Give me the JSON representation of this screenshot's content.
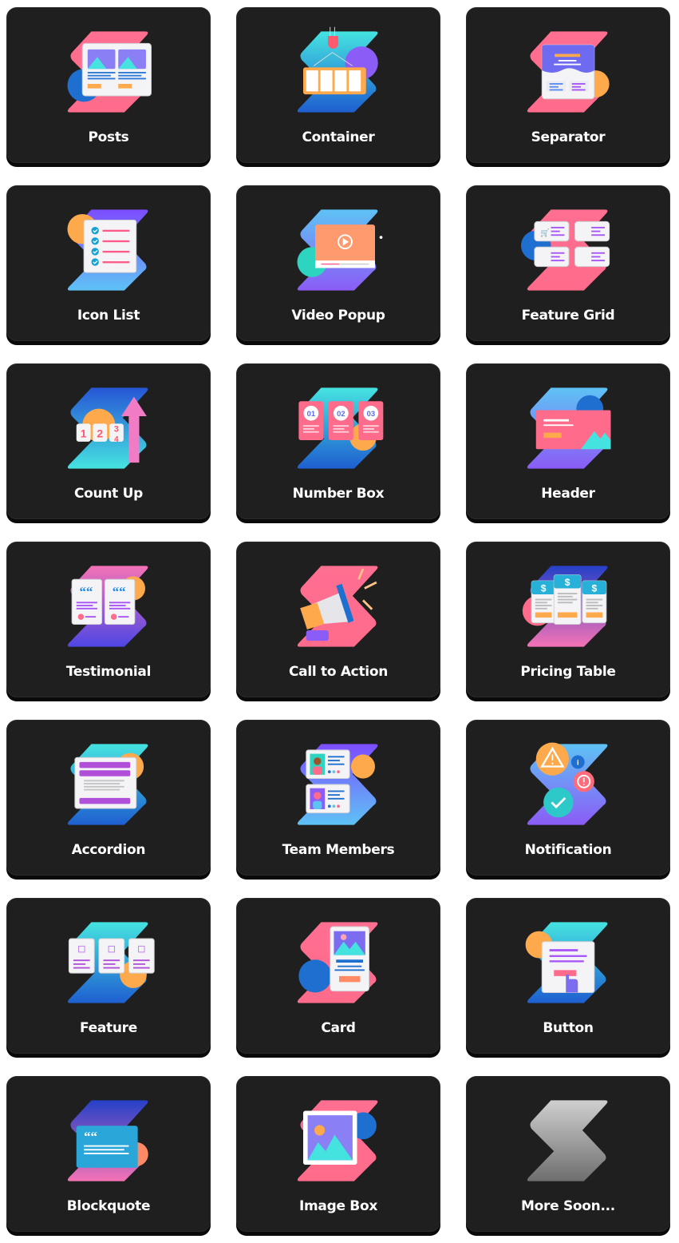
{
  "widgets": [
    {
      "label": "Posts",
      "icon": "posts-icon",
      "motif": "pink",
      "accent": "#1e6fd0"
    },
    {
      "label": "Container",
      "icon": "container-icon",
      "motif": "cyan-blue",
      "accent": "#8b5cf6"
    },
    {
      "label": "Separator",
      "icon": "separator-icon",
      "motif": "pink",
      "accent": "#ffa94d"
    },
    {
      "label": "Icon List",
      "icon": "icon-list-icon",
      "motif": "purple-sky",
      "accent": "#ffa94d"
    },
    {
      "label": "Video Popup",
      "icon": "video-popup-icon",
      "motif": "sky-purple",
      "accent": "#2dd4bf"
    },
    {
      "label": "Feature Grid",
      "icon": "feature-grid-icon",
      "motif": "pink",
      "accent": "#1e6fd0"
    },
    {
      "label": "Count Up",
      "icon": "count-up-icon",
      "motif": "blue-cyan",
      "accent": "#ffa94d"
    },
    {
      "label": "Number Box",
      "icon": "number-box-icon",
      "motif": "cyan-blue",
      "accent": "#ffa94d"
    },
    {
      "label": "Header",
      "icon": "header-icon",
      "motif": "sky-purple",
      "accent": "#1e6fd0"
    },
    {
      "label": "Testimonial",
      "icon": "testimonial-icon",
      "motif": "pink-purple",
      "accent": "#ffa94d"
    },
    {
      "label": "Call to Action",
      "icon": "megaphone-icon",
      "motif": "pink",
      "accent": "#ffa94d"
    },
    {
      "label": "Pricing Table",
      "icon": "pricing-table-icon",
      "motif": "blue-pink",
      "accent": "#f472b6"
    },
    {
      "label": "Accordion",
      "icon": "accordion-icon",
      "motif": "cyan-blue",
      "accent": "#ffa94d"
    },
    {
      "label": "Team Members",
      "icon": "team-members-icon",
      "motif": "purple-sky",
      "accent": "#ffa94d"
    },
    {
      "label": "Notification",
      "icon": "notification-icon",
      "motif": "sky-purple",
      "accent": "#ffa94d"
    },
    {
      "label": "Feature",
      "icon": "feature-icon",
      "motif": "cyan-blue",
      "accent": "#ffa94d"
    },
    {
      "label": "Card",
      "icon": "card-icon",
      "motif": "pink",
      "accent": "#1e6fd0"
    },
    {
      "label": "Button",
      "icon": "button-icon",
      "motif": "cyan-blue",
      "accent": "#ffa94d"
    },
    {
      "label": "Blockquote",
      "icon": "blockquote-icon",
      "motif": "blue-pink",
      "accent": "#ff8a65"
    },
    {
      "label": "Image Box",
      "icon": "image-box-icon",
      "motif": "pink",
      "accent": "#1e6fd0"
    },
    {
      "label": "More Soon...",
      "icon": "more-soon-icon",
      "motif": "gray",
      "accent": ""
    }
  ],
  "count_up_digits": [
    "1",
    "2",
    "3",
    "4"
  ],
  "number_box_digits": [
    "01",
    "02",
    "03"
  ],
  "pricing_symbol": "$",
  "quote_glyph": "“"
}
